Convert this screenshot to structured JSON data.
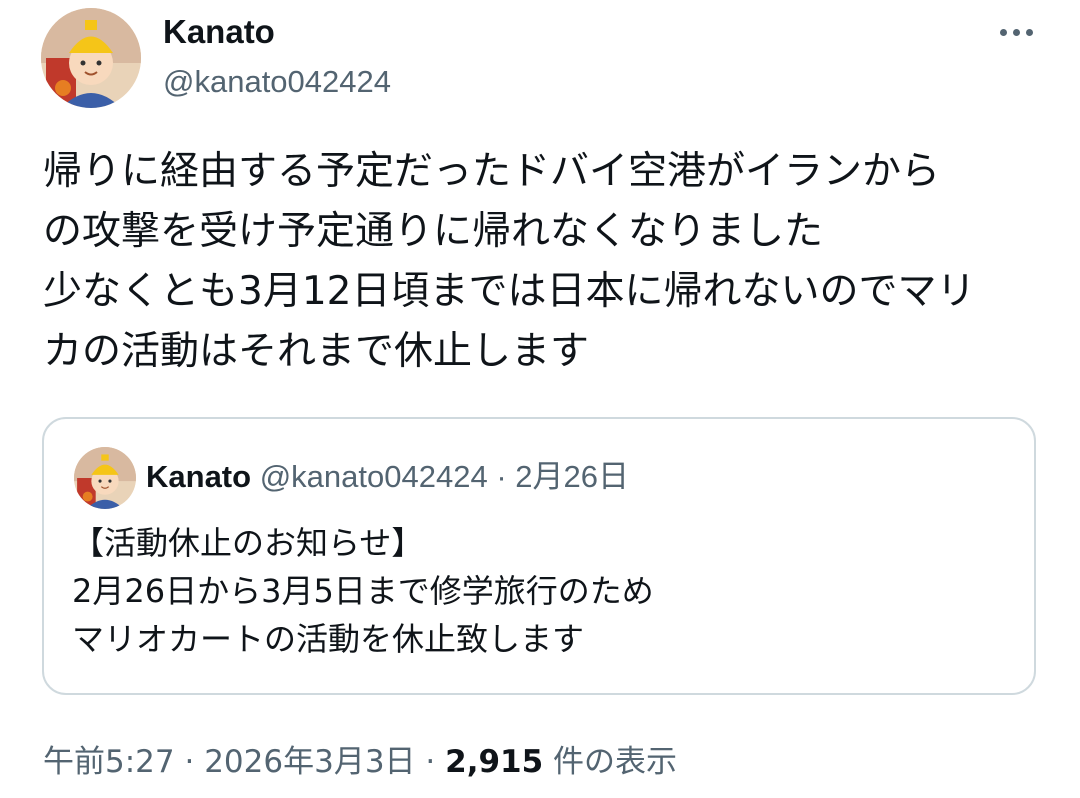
{
  "author": {
    "display_name": "Kanato",
    "handle": "@kanato042424"
  },
  "more_icon": "ellipsis-icon",
  "tweet": {
    "lines": [
      "帰りに経由する予定だったドバイ空港がイランから",
      "の攻撃を受け予定通りに帰れなくなりました",
      "少なくとも3月12日頃までは日本に帰れないのでマリ",
      "カの活動はそれまで休止します"
    ]
  },
  "quote": {
    "display_name": "Kanato",
    "handle": "@kanato042424",
    "separator": "·",
    "date": "2月26日",
    "lines": [
      "【活動休止のお知らせ】",
      "2月26日から3月5日まで修学旅行のため",
      "マリオカートの活動を休止致します"
    ]
  },
  "meta": {
    "time": "午前5:27",
    "separator": "·",
    "date": "2026年3月3日",
    "views_count": "2,915",
    "views_label": "件の表示"
  },
  "colors": {
    "text": "#0f1419",
    "secondary": "#536471",
    "border": "#cfd9de"
  }
}
